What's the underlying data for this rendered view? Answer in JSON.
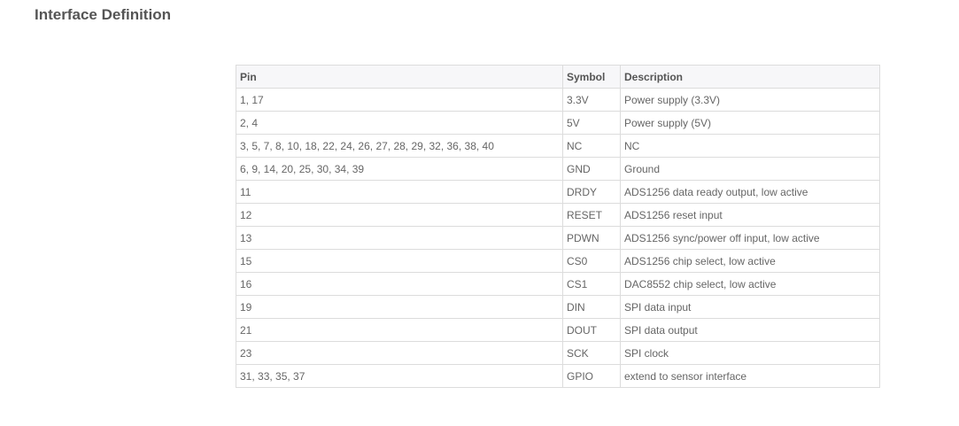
{
  "title": "Interface Definition",
  "table": {
    "headers": [
      "Pin",
      "Symbol",
      "Description"
    ],
    "rows": [
      [
        "1, 17",
        "3.3V",
        "Power supply (3.3V)"
      ],
      [
        "2, 4",
        "5V",
        "Power supply (5V)"
      ],
      [
        "3, 5, 7, 8, 10, 18, 22, 24, 26, 27, 28, 29, 32, 36, 38, 40",
        "NC",
        "NC"
      ],
      [
        "6, 9, 14, 20, 25, 30, 34, 39",
        "GND",
        "Ground"
      ],
      [
        "11",
        "DRDY",
        "ADS1256 data ready output, low active"
      ],
      [
        "12",
        "RESET",
        "ADS1256 reset input"
      ],
      [
        "13",
        "PDWN",
        "ADS1256 sync/power off input, low active"
      ],
      [
        "15",
        "CS0",
        "ADS1256 chip select, low active"
      ],
      [
        "16",
        "CS1",
        "DAC8552 chip select, low active"
      ],
      [
        "19",
        "DIN",
        "SPI data input"
      ],
      [
        "21",
        "DOUT",
        "SPI data output"
      ],
      [
        "23",
        "SCK",
        "SPI clock"
      ],
      [
        "31, 33, 35, 37",
        "GPIO",
        "extend to sensor interface"
      ]
    ]
  }
}
